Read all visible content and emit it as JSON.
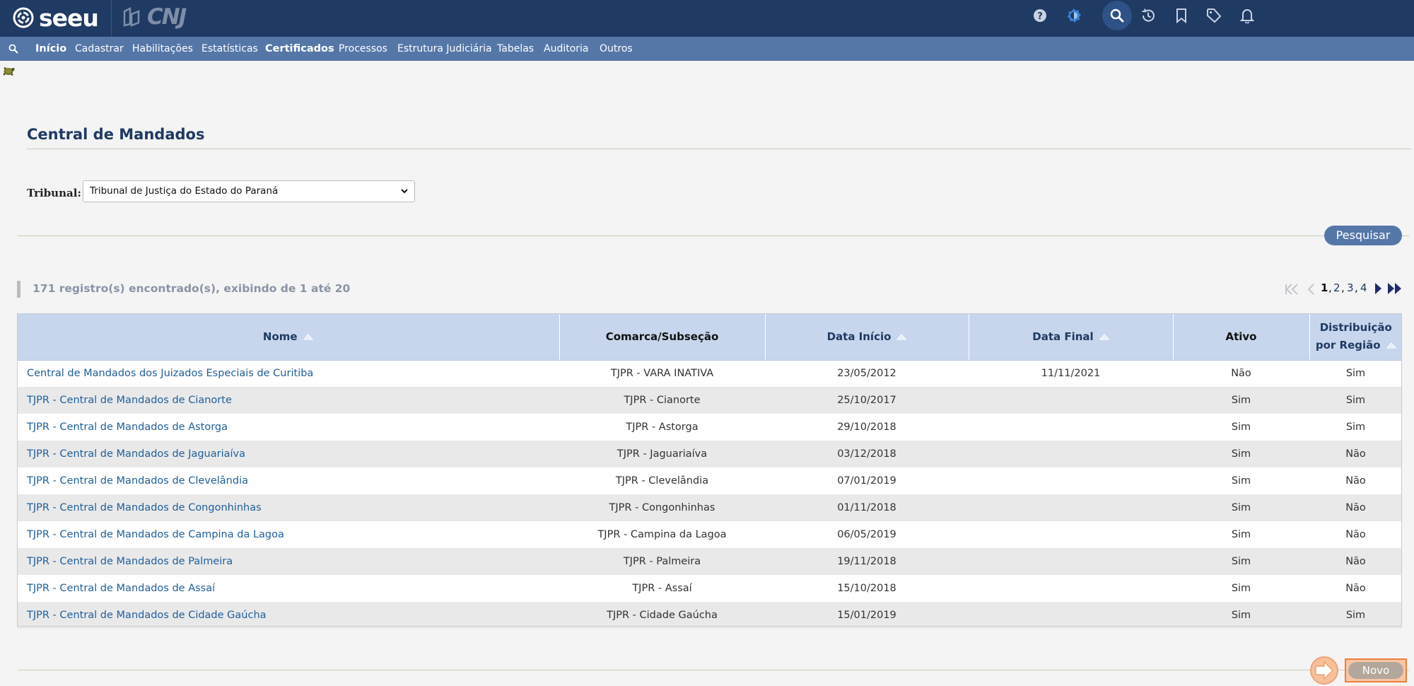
{
  "header": {
    "logo_text": "seeu",
    "cnj_text": "CNJ",
    "icons": [
      "help-icon",
      "contrast-icon",
      "search-icon",
      "history-icon",
      "bookmark-icon",
      "tag-icon",
      "bell-icon"
    ]
  },
  "menu": {
    "search_icon": "search-icon",
    "items": [
      {
        "label": "Início"
      },
      {
        "label": "Cadastrar"
      },
      {
        "label": "Habilitações"
      },
      {
        "label": "Estatísticas"
      },
      {
        "label": "Certificados"
      },
      {
        "label": "Processos"
      },
      {
        "label": "Estrutura Judiciária"
      },
      {
        "label": "Tabelas"
      },
      {
        "label": "Auditoria"
      },
      {
        "label": "Outros"
      }
    ]
  },
  "page": {
    "title": "Central de Mandados",
    "tribunal_label": "Tribunal:",
    "tribunal_value": "Tribunal de Justiça do Estado do Paraná",
    "search_button": "Pesquisar",
    "records_text": "171 registro(s) encontrado(s), exibindo de 1 até 20",
    "novo_button": "Novo"
  },
  "pagination": {
    "pages": [
      "1",
      "2",
      "3",
      "4"
    ],
    "current": "1"
  },
  "table": {
    "headers": {
      "nome": "Nome",
      "comarca": "Comarca/Subseção",
      "data_inicio": "Data Início",
      "data_final": "Data Final",
      "ativo": "Ativo",
      "distribuicao_1": "Distribuição",
      "distribuicao_2": "por Região"
    },
    "rows": [
      {
        "nome": "Central de Mandados dos Juizados Especiais de Curitiba",
        "comarca": "TJPR - VARA INATIVA",
        "inicio": "23/05/2012",
        "final": "11/11/2021",
        "ativo": "Não",
        "distribuicao": "Sim"
      },
      {
        "nome": "TJPR - Central de Mandados de Cianorte",
        "comarca": "TJPR - Cianorte",
        "inicio": "25/10/2017",
        "final": "",
        "ativo": "Sim",
        "distribuicao": "Sim"
      },
      {
        "nome": "TJPR - Central de Mandados de Astorga",
        "comarca": "TJPR - Astorga",
        "inicio": "29/10/2018",
        "final": "",
        "ativo": "Sim",
        "distribuicao": "Sim"
      },
      {
        "nome": "TJPR - Central de Mandados de Jaguariaíva",
        "comarca": "TJPR - Jaguariaíva",
        "inicio": "03/12/2018",
        "final": "",
        "ativo": "Sim",
        "distribuicao": "Não"
      },
      {
        "nome": "TJPR - Central de Mandados de Clevelândia",
        "comarca": "TJPR - Clevelândia",
        "inicio": "07/01/2019",
        "final": "",
        "ativo": "Sim",
        "distribuicao": "Não"
      },
      {
        "nome": "TJPR - Central de Mandados de Congonhinhas",
        "comarca": "TJPR - Congonhinhas",
        "inicio": "01/11/2018",
        "final": "",
        "ativo": "Sim",
        "distribuicao": "Não"
      },
      {
        "nome": "TJPR - Central de Mandados de Campina da Lagoa",
        "comarca": "TJPR - Campina da Lagoa",
        "inicio": "06/05/2019",
        "final": "",
        "ativo": "Sim",
        "distribuicao": "Não"
      },
      {
        "nome": "TJPR - Central de Mandados de Palmeira",
        "comarca": "TJPR - Palmeira",
        "inicio": "19/11/2018",
        "final": "",
        "ativo": "Sim",
        "distribuicao": "Não"
      },
      {
        "nome": "TJPR - Central de Mandados de Assaí",
        "comarca": "TJPR - Assaí",
        "inicio": "15/10/2018",
        "final": "",
        "ativo": "Sim",
        "distribuicao": "Não"
      },
      {
        "nome": "TJPR - Central de Mandados de Cidade Gaúcha",
        "comarca": "TJPR - Cidade Gaúcha",
        "inicio": "15/01/2019",
        "final": "",
        "ativo": "Sim",
        "distribuicao": "Sim"
      }
    ]
  },
  "colors": {
    "topbar": "#1f3a63",
    "menubar": "#5577a8",
    "header_row": "#c7d6ec",
    "link": "#1f5f99",
    "novo_highlight": "#ee7f3c"
  }
}
